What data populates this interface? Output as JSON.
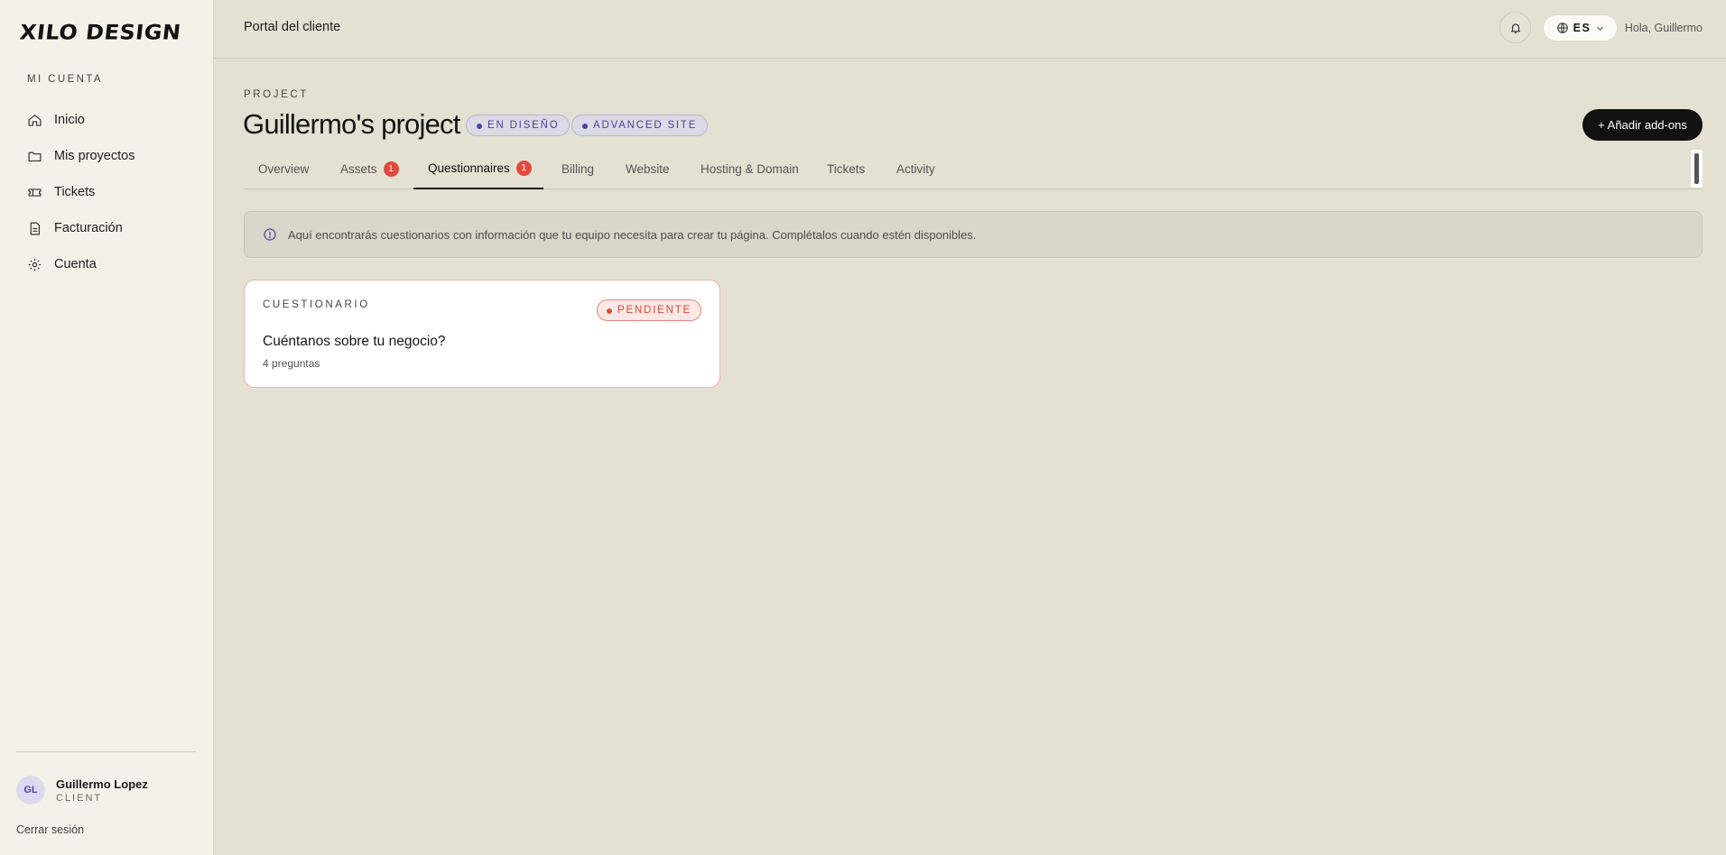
{
  "brand": {
    "logo_text": "XILO DESIGN"
  },
  "sidebar": {
    "section_label": "MI CUENTA",
    "items": [
      {
        "label": "Inicio",
        "icon": "home-icon"
      },
      {
        "label": "Mis proyectos",
        "icon": "folder-icon"
      },
      {
        "label": "Tickets",
        "icon": "ticket-icon"
      },
      {
        "label": "Facturación",
        "icon": "invoice-icon"
      },
      {
        "label": "Cuenta",
        "icon": "gear-icon"
      }
    ],
    "user": {
      "initials": "GL",
      "name": "Guillermo Lopez",
      "role": "CLIENT"
    },
    "logout_label": "Cerrar sesión"
  },
  "topbar": {
    "title": "Portal del cliente",
    "language": "ES",
    "greeting": "Hola, Guillermo"
  },
  "project": {
    "kicker": "PROJECT",
    "title": "Guillermo's project",
    "status_badge": "EN DISEÑO",
    "plan_badge": "ADVANCED SITE",
    "add_button": "+ Añadir add-ons"
  },
  "tabs": [
    {
      "label": "Overview",
      "badge": null
    },
    {
      "label": "Assets",
      "badge": "1"
    },
    {
      "label": "Questionnaires",
      "badge": "1",
      "active": true
    },
    {
      "label": "Billing",
      "badge": null
    },
    {
      "label": "Website",
      "badge": null
    },
    {
      "label": "Hosting & Domain",
      "badge": null
    },
    {
      "label": "Tickets",
      "badge": null
    },
    {
      "label": "Activity",
      "badge": null
    }
  ],
  "info_text": "Aquí encontrarás cuestionarios con información que tu equipo necesita para crear tu página. Complétalos cuando estén disponibles.",
  "questionnaire_card": {
    "kicker": "CUESTIONARIO",
    "status": "PENDIENTE",
    "title": "Cuéntanos sobre tu negocio?",
    "subtitle": "4 preguntas"
  },
  "colors": {
    "accent_indigo": "#4744a0",
    "alert_red": "#e2483d",
    "background": "#e4e1d3",
    "sidebar_bg": "#f4f2e8"
  }
}
